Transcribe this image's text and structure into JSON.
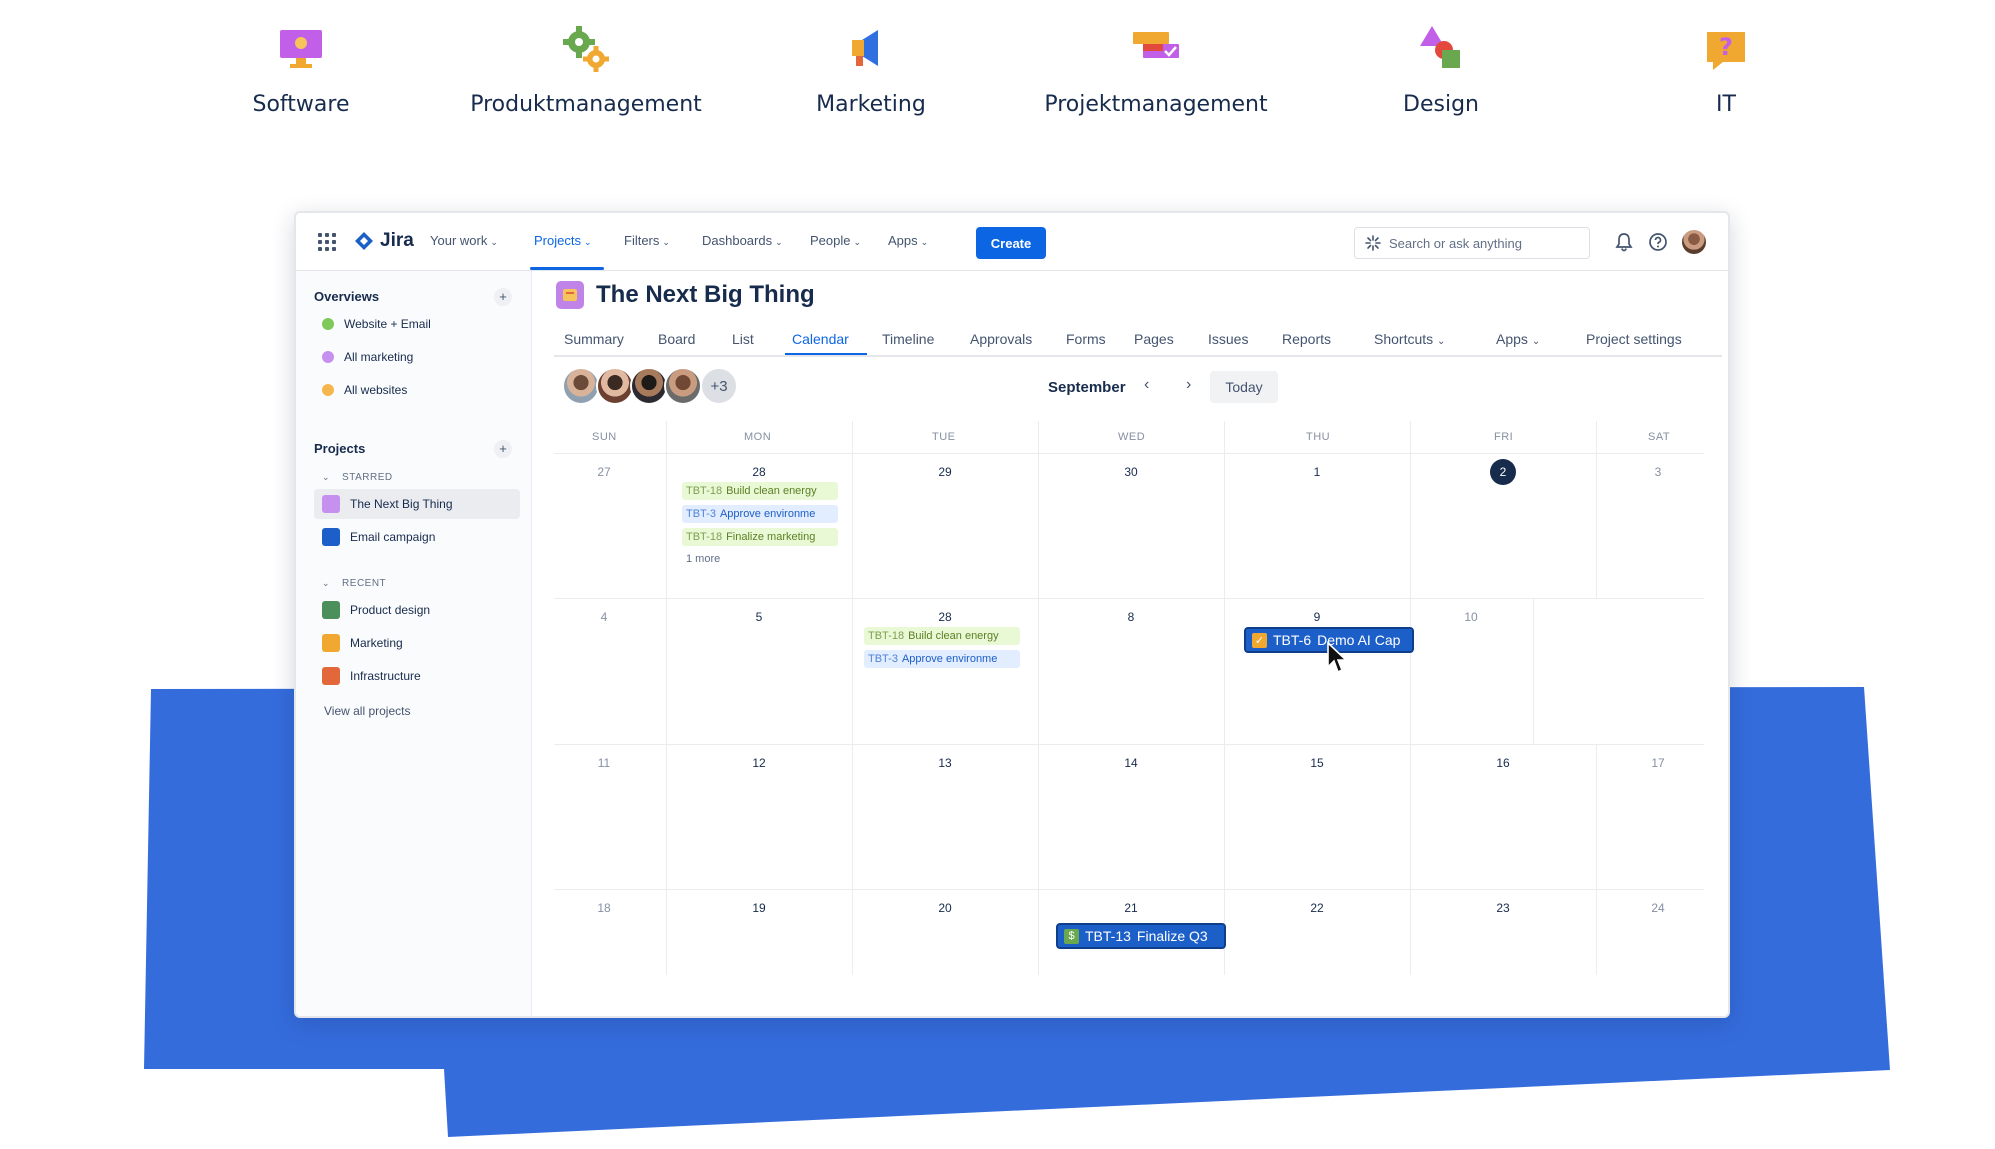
{
  "categories": [
    {
      "label": "Software",
      "icon": "monitor-icon"
    },
    {
      "label": "Produktmanagement",
      "icon": "gears-icon"
    },
    {
      "label": "Marketing",
      "icon": "megaphone-icon"
    },
    {
      "label": "Projektmanagement",
      "icon": "task-cards-icon"
    },
    {
      "label": "Design",
      "icon": "shapes-icon"
    },
    {
      "label": "IT",
      "icon": "help-bubble-icon"
    }
  ],
  "colors": {
    "backdrop": "#356cdc",
    "accent": "#0c66e4",
    "today": "#172b4d"
  },
  "topnav": {
    "brand": "Jira",
    "items": [
      "Your work",
      "Projects",
      "Filters",
      "Dashboards",
      "People",
      "Apps"
    ],
    "active": "Projects",
    "create_label": "Create",
    "search_placeholder": "Search or ask anything"
  },
  "sidebar": {
    "overviews_title": "Overviews",
    "overviews": [
      {
        "label": "Website + Email",
        "color": "#7fc95a"
      },
      {
        "label": "All marketing",
        "color": "#c690ef"
      },
      {
        "label": "All websites",
        "color": "#f5b74d"
      }
    ],
    "projects_title": "Projects",
    "starred_label": "STARRED",
    "starred": [
      "The Next Big Thing",
      "Email campaign"
    ],
    "recent_label": "RECENT",
    "recent": [
      "Product design",
      "Marketing",
      "Infrastructure"
    ],
    "view_all": "View all projects"
  },
  "project": {
    "title": "The Next Big Thing",
    "tabs": [
      "Summary",
      "Board",
      "List",
      "Calendar",
      "Timeline",
      "Approvals",
      "Forms",
      "Pages",
      "Issues",
      "Reports",
      "Shortcuts",
      "Apps",
      "Project settings"
    ],
    "active_tab": "Calendar",
    "more_people": "+3"
  },
  "calendar": {
    "month": "September",
    "today_label": "Today",
    "weekdays": [
      "SUN",
      "MON",
      "TUE",
      "WED",
      "THU",
      "FRI",
      "SAT"
    ],
    "weeks": [
      [
        "27",
        "28",
        "29",
        "30",
        "1",
        "2",
        "3"
      ],
      [
        "4",
        "5",
        "28",
        "8",
        "9",
        "10",
        ""
      ],
      [
        "11",
        "12",
        "13",
        "14",
        "15",
        "16",
        "17"
      ],
      [
        "18",
        "19",
        "20",
        "21",
        "22",
        "23",
        "24"
      ]
    ],
    "today_day": "2",
    "events": {
      "w1_mon_1": {
        "key": "TBT-18",
        "title": "Build clean energy"
      },
      "w1_mon_2": {
        "key": "TBT-3",
        "title": "Approve environme"
      },
      "w1_mon_3": {
        "key": "TBT-18",
        "title": "Finalize marketing"
      },
      "w1_more": "1 more",
      "w2_tue_1": {
        "key": "TBT-18",
        "title": "Build clean energy"
      },
      "w2_tue_2": {
        "key": "TBT-3",
        "title": "Approve environme"
      },
      "w2_thu": {
        "key": "TBT-6",
        "title": "Demo AI Cap"
      },
      "w4_wed": {
        "key": "TBT-13",
        "title": "Finalize Q3"
      }
    }
  }
}
